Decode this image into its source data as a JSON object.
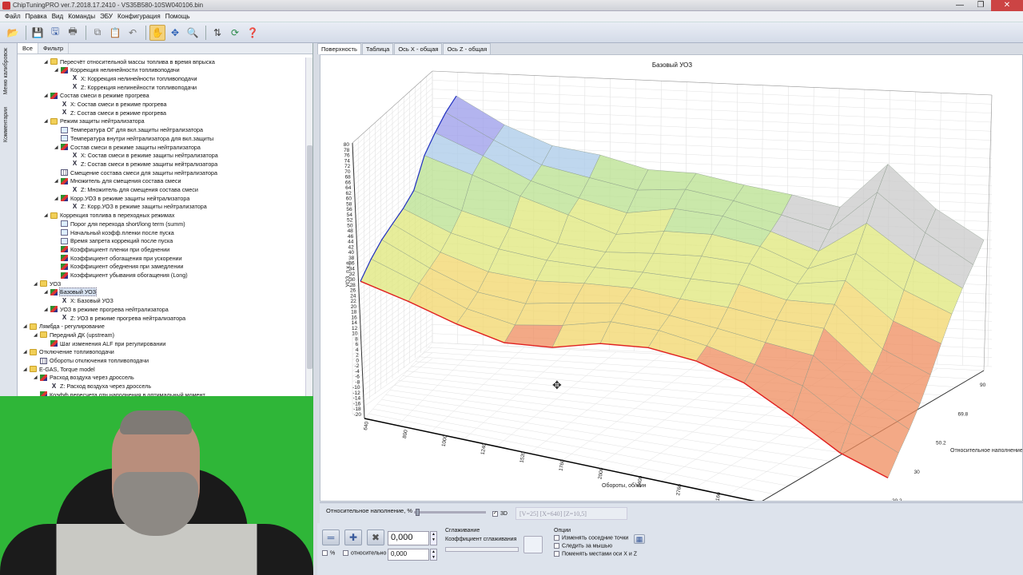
{
  "window": {
    "title": "ChipTuningPRO ver.7.2018.17.2410 - VS35B580-10SW040106.bin",
    "controls": [
      "—",
      "❐",
      "✕"
    ]
  },
  "menu": [
    "Файл",
    "Правка",
    "Вид",
    "Команды",
    "ЭБУ",
    "Конфигурация",
    "Помощь"
  ],
  "left_strip": {
    "tab1": "Меню калибровок",
    "tab2": "Комментарии"
  },
  "left_panel": {
    "tabs": [
      "Все",
      "Фильтр"
    ],
    "tree": [
      {
        "label": "Пересчёт относительной массы топлива в время впрыска",
        "icon": "folder",
        "indent": 3,
        "expanded": true
      },
      {
        "label": "Коррекция нелинейности топливоподачи",
        "icon": "map",
        "indent": 4,
        "expanded": true
      },
      {
        "label": "X: Коррекция нелинейности топливоподачи",
        "icon": "x",
        "indent": 5
      },
      {
        "label": "Z: Коррекция нелинейности топливоподачи",
        "icon": "x",
        "indent": 5
      },
      {
        "label": "Состав смеси в режиме прогрева",
        "icon": "map",
        "indent": 3,
        "expanded": true
      },
      {
        "label": "X: Состав смеси в режиме прогрева",
        "icon": "x",
        "indent": 4
      },
      {
        "label": "Z: Состав смеси в режиме прогрева",
        "icon": "x",
        "indent": 4
      },
      {
        "label": "Режим защиты нейтрализатора",
        "icon": "folder",
        "indent": 3,
        "expanded": true
      },
      {
        "label": "Температура ОГ для вкл.защиты нейтрализатора",
        "icon": "val",
        "indent": 4
      },
      {
        "label": "Температура внутри нейтрализатора для вкл.защиты",
        "icon": "val",
        "indent": 4
      },
      {
        "label": "Состав смеси в режиме защиты нейтрализатора",
        "icon": "map",
        "indent": 4,
        "expanded": true
      },
      {
        "label": "X: Состав смеси в режиме защиты нейтрализатора",
        "icon": "x",
        "indent": 5
      },
      {
        "label": "Z: Состав смеси в режиме защиты нейтрализатора",
        "icon": "x",
        "indent": 5
      },
      {
        "label": "Смещение состава смеси для защиты нейтрализатора",
        "icon": "tbl",
        "indent": 4
      },
      {
        "label": "Множитель для смещения состава смеси",
        "icon": "map",
        "indent": 4,
        "expanded": true
      },
      {
        "label": "Z: Множитель для смещения состава смеси",
        "icon": "x",
        "indent": 5
      },
      {
        "label": "Корр.УОЗ в режиме защиты нейтрализатора",
        "icon": "map",
        "indent": 4,
        "expanded": true
      },
      {
        "label": "Z: Корр.УОЗ в режиме защиты нейтрализатора",
        "icon": "x",
        "indent": 5
      },
      {
        "label": "Коррекция топлива в переходных режимах",
        "icon": "folder",
        "indent": 3,
        "expanded": true
      },
      {
        "label": "Порог для перехода short/long term (summ)",
        "icon": "val",
        "indent": 4
      },
      {
        "label": "Начальный коэфф.пленки после пуска",
        "icon": "val",
        "indent": 4
      },
      {
        "label": "Время запрета коррекций после пуска",
        "icon": "val",
        "indent": 4
      },
      {
        "label": "Коэффициент пленки при обеднении",
        "icon": "map",
        "indent": 4
      },
      {
        "label": "Коэффициент обогащения при ускорении",
        "icon": "map",
        "indent": 4
      },
      {
        "label": "Коэффициент обеднения при замедлении",
        "icon": "map",
        "indent": 4
      },
      {
        "label": "Коэффициент убывания обогащения (Long)",
        "icon": "map",
        "indent": 4
      },
      {
        "label": "УОЗ",
        "icon": "folder",
        "indent": 2,
        "expanded": true
      },
      {
        "label": "Базовый УОЗ",
        "icon": "map",
        "indent": 3,
        "expanded": true,
        "selected": true
      },
      {
        "label": "X: Базовый УОЗ",
        "icon": "x",
        "indent": 4
      },
      {
        "label": "УОЗ в режиме прогрева нейтрализатора",
        "icon": "map",
        "indent": 3,
        "expanded": true
      },
      {
        "label": "Z: УОЗ в режиме прогрева нейтрализатора",
        "icon": "x",
        "indent": 4
      },
      {
        "label": "Лямбда - регулирование",
        "icon": "folder",
        "indent": 1,
        "expanded": true
      },
      {
        "label": "Передний ДК (upstream)",
        "icon": "folder",
        "indent": 2,
        "expanded": true
      },
      {
        "label": "Шаг изменения ALF при регулировании",
        "icon": "map",
        "indent": 3
      },
      {
        "label": "Отключение топливоподачи",
        "icon": "folder",
        "indent": 1,
        "expanded": true
      },
      {
        "label": "Обороты отключения топливоподачи",
        "icon": "tbl",
        "indent": 2
      },
      {
        "label": "E-GAS, Torque model",
        "icon": "folder",
        "indent": 1,
        "expanded": true
      },
      {
        "label": "Расход воздуха через дроссель",
        "icon": "map",
        "indent": 2,
        "expanded": true
      },
      {
        "label": "Z: Расход воздуха через дроссель",
        "icon": "x",
        "indent": 3
      },
      {
        "label": "Коэфф.пересчета отн.наполнения в оптимальный момент",
        "icon": "map",
        "indent": 2
      }
    ]
  },
  "right_panel": {
    "tabs": [
      "Поверхность",
      "Таблица",
      "Ось X - общая",
      "Ось Z - общая"
    ],
    "active_tab": "Поверхность"
  },
  "chart_data": {
    "type": "surface-3d",
    "title": "Базовый УОЗ",
    "ylabel": "УОЗ, п.к.в.",
    "xlabel": "Обороты, об/мин",
    "zlabel": "Относительное наполнение",
    "yticks": [
      "80",
      "78",
      "76",
      "74",
      "72",
      "70",
      "68",
      "66",
      "64",
      "62",
      "60",
      "58",
      "56",
      "54",
      "52",
      "50",
      "48",
      "46",
      "44",
      "42",
      "40",
      "38",
      "36",
      "34",
      "32",
      "30",
      "28",
      "26",
      "24",
      "22",
      "20",
      "18",
      "16",
      "14",
      "12",
      "10",
      "8",
      "6",
      "4",
      "2",
      "0",
      "-2",
      "-4",
      "-6",
      "-8",
      "-10",
      "-12",
      "-14",
      "-16",
      "-18",
      "-20"
    ],
    "xticks": [
      "640",
      "800",
      "1000",
      "1240",
      "1520",
      "1760",
      "2000",
      "2400",
      "2760",
      "3160"
    ],
    "zticks": [
      "90",
      "69.8",
      "50.2",
      "30",
      "20.2"
    ],
    "front_edge_values": [
      24,
      19,
      15,
      13,
      14,
      16,
      16,
      15,
      12,
      4,
      -6,
      -12
    ],
    "surface_colors": {
      "low": "#e8524a",
      "mid": "#f3e36a",
      "high": "#9ad48a",
      "peak": "#8a8ae6",
      "masked": "#bdbdbd"
    }
  },
  "slider_bar": {
    "label": "Относительное наполнение, %",
    "check_3d_label": "3D",
    "check_3d": true,
    "readout": "[V=25] [X=640] [Z=10,5]"
  },
  "bottom": {
    "value": "0,000",
    "value2": "0,000",
    "percent_label": "%",
    "relative_label": "относительно",
    "smoothing_title": "Сглаживание",
    "smoothing_coef_label": "Коэффициент сглаживания",
    "options_title": "Опции",
    "options": [
      "Изменять соседние точки",
      "Следить за мышью",
      "Поменять местами оси X и Z"
    ]
  }
}
